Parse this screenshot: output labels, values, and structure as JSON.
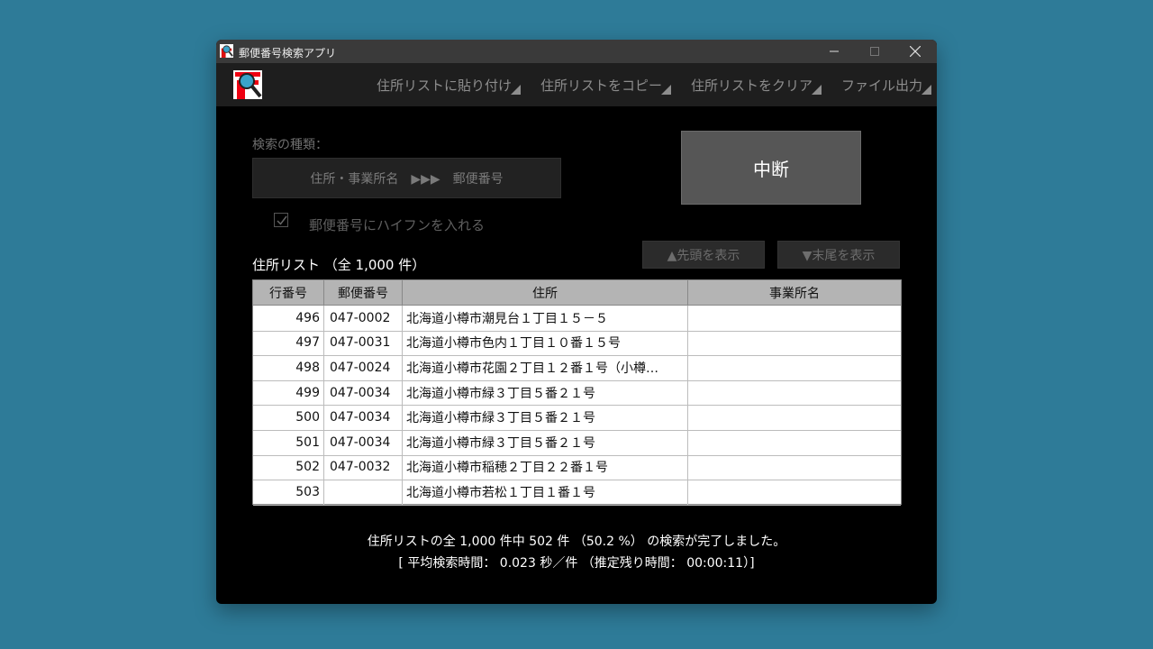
{
  "window": {
    "title": "郵便番号検索アプリ",
    "min_icon": "minimize-icon",
    "max_icon": "maximize-icon",
    "close_icon": "close-icon"
  },
  "menu": [
    {
      "label": "住所リストに貼り付け"
    },
    {
      "label": "住所リストをコピー"
    },
    {
      "label": "住所リストをクリア"
    },
    {
      "label": "ファイル出力"
    }
  ],
  "search": {
    "kind_label": "検索の種類：",
    "kind_value": "住所・事業所名　▶▶▶　郵便番号",
    "hyphen_label": "郵便番号にハイフンを入れる",
    "hyphen_checked": true
  },
  "stop_button": "中断",
  "list": {
    "title": "住所リスト （全 1,000 件）",
    "first_button": "▲先頭を表示",
    "last_button": "▼末尾を表示",
    "headers": [
      "行番号",
      "郵便番号",
      "住所",
      "事業所名"
    ],
    "rows": [
      [
        "496",
        "047-0002",
        "北海道小樽市潮見台１丁目１５－５",
        ""
      ],
      [
        "497",
        "047-0031",
        "北海道小樽市色内１丁目１０番１５号",
        ""
      ],
      [
        "498",
        "047-0024",
        "北海道小樽市花園２丁目１２番１号（小樽…",
        ""
      ],
      [
        "499",
        "047-0034",
        "北海道小樽市緑３丁目５番２１号",
        ""
      ],
      [
        "500",
        "047-0034",
        "北海道小樽市緑３丁目５番２１号",
        ""
      ],
      [
        "501",
        "047-0034",
        "北海道小樽市緑３丁目５番２１号",
        ""
      ],
      [
        "502",
        "047-0032",
        "北海道小樽市稲穂２丁目２２番１号",
        ""
      ],
      [
        "503",
        "",
        "北海道小樽市若松１丁目１番１号",
        ""
      ]
    ]
  },
  "status": {
    "line1": "住所リストの全 1,000 件中 502 件 （50.2 %） の検索が完了しました。",
    "line2": "[ 平均検索時間： 0.023 秒／件 （推定残り時間： 00:00:11）]"
  }
}
